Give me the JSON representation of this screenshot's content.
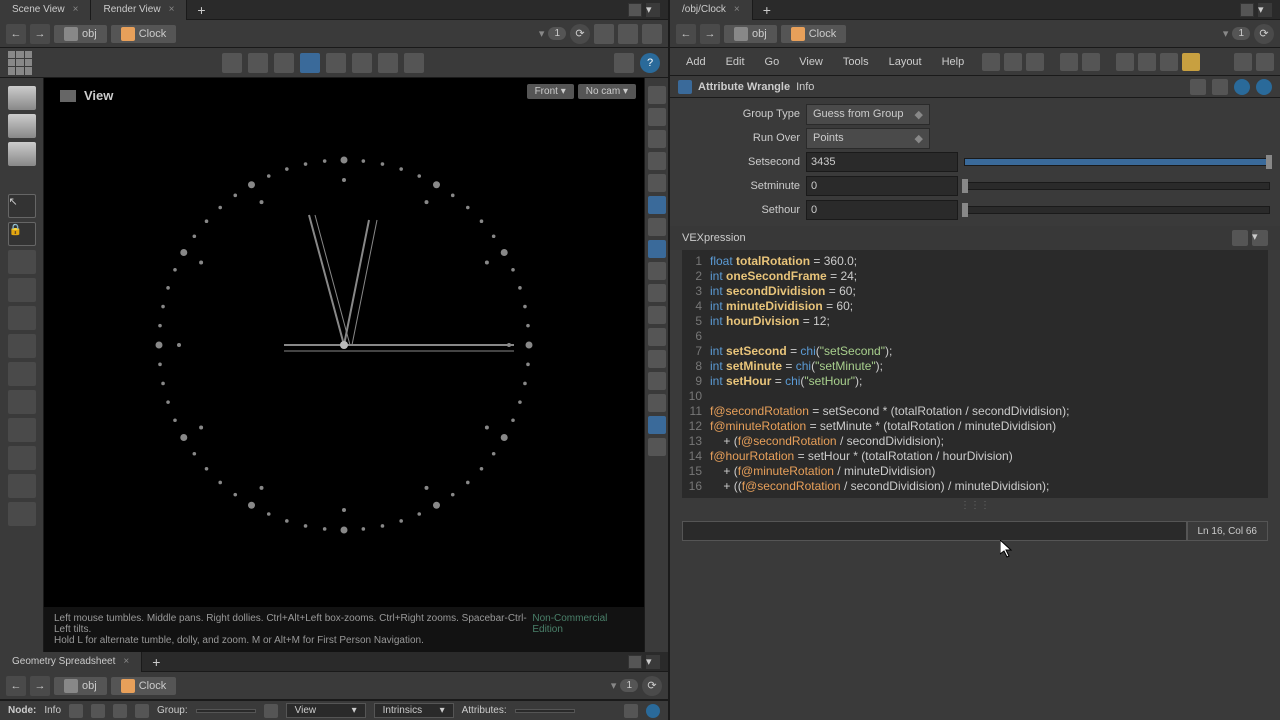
{
  "left": {
    "tabs": [
      "Scene View",
      "Render View"
    ],
    "breadcrumb": {
      "root": "obj",
      "node": "Clock"
    },
    "view_label": "View",
    "view_front": "Front",
    "view_cam": "No cam",
    "help1": "Left mouse tumbles. Middle pans. Right dollies. Ctrl+Alt+Left box-zooms. Ctrl+Right zooms. Spacebar-Ctrl-Left tilts.",
    "help2": "Hold L for alternate tumble, dolly, and zoom. M or Alt+M for First Person Navigation.",
    "nc_label": "Non-Commercial Edition",
    "geom_tab": "Geometry Spreadsheet",
    "bottom": {
      "node_label": "Node:",
      "node_value": "Info",
      "group_label": "Group:",
      "view_label": "View",
      "intrinsics_label": "Intrinsics",
      "attrs_label": "Attributes:"
    }
  },
  "right": {
    "tab": "/obj/Clock",
    "breadcrumb": {
      "root": "obj",
      "node": "Clock"
    },
    "menus": [
      "Add",
      "Edit",
      "Go",
      "View",
      "Tools",
      "Layout",
      "Help"
    ],
    "node_title": "Attribute Wrangle",
    "node_sub": "Info",
    "params": {
      "group_type": {
        "label": "Group Type",
        "value": "Guess from Group"
      },
      "run_over": {
        "label": "Run Over",
        "value": "Points"
      },
      "setsecond": {
        "label": "Setsecond",
        "value": "3435"
      },
      "setminute": {
        "label": "Setminute",
        "value": "0"
      },
      "sethour": {
        "label": "Sethour",
        "value": "0"
      }
    },
    "vex_label": "VEXpression",
    "status_pos": "Ln 16, Col 66",
    "pin": "1"
  }
}
